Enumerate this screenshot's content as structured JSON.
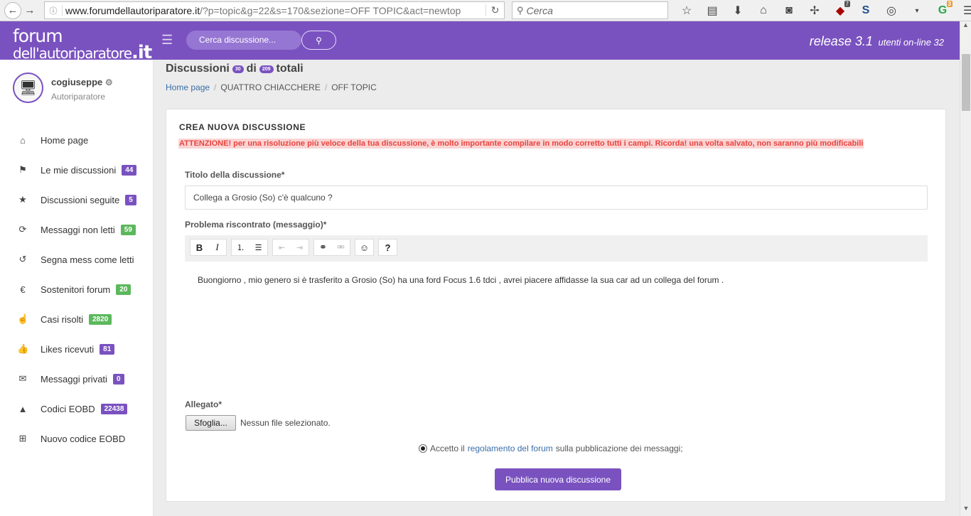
{
  "browser": {
    "url_host": "www.forumdellautoriparatore.it",
    "url_path": "/?p=topic&g=22&s=170&sezione=OFF TOPIC&act=newtop",
    "search_placeholder": "Cerca",
    "ublock_badge": "7",
    "ext_badge": "3"
  },
  "header": {
    "logo_line1": "forum",
    "logo_line2": "dell'autoriparatore",
    "logo_tld": ".it",
    "search_placeholder": "Cerca discussione...",
    "release": "release 3.1",
    "online": "utenti on-line 32"
  },
  "user": {
    "name": "cogiuseppe",
    "role": "Autoriparatore"
  },
  "menu": [
    {
      "label": "Home page",
      "icon": "home-icon",
      "glyph": "⌂",
      "badge": "",
      "color": ""
    },
    {
      "label": "Le mie discussioni",
      "icon": "flag-icon",
      "glyph": "⚑",
      "badge": "44",
      "color": "#7a52c0"
    },
    {
      "label": "Discussioni seguite",
      "icon": "star-icon",
      "glyph": "★",
      "badge": "5",
      "color": "#7a52c0"
    },
    {
      "label": "Messaggi non letti",
      "icon": "refresh-icon",
      "glyph": "⟳",
      "badge": "59",
      "color": "#5cb85c"
    },
    {
      "label": "Segna mess come letti",
      "icon": "history-icon",
      "glyph": "↺",
      "badge": "",
      "color": ""
    },
    {
      "label": "Sostenitori forum",
      "icon": "euro-icon",
      "glyph": "€",
      "badge": "20",
      "color": "#5cb85c"
    },
    {
      "label": "Casi risolti",
      "icon": "hand-icon",
      "glyph": "☝",
      "badge": "2820",
      "color": "#5cb85c"
    },
    {
      "label": "Likes ricevuti",
      "icon": "thumbs-up-icon",
      "glyph": "👍",
      "badge": "81",
      "color": "#7a52c0"
    },
    {
      "label": "Messaggi privati",
      "icon": "chat-icon",
      "glyph": "✉",
      "badge": "0",
      "color": "#7a52c0"
    },
    {
      "label": "Codici EOBD",
      "icon": "warning-icon",
      "glyph": "▲",
      "badge": "22438",
      "color": "#7a52c0"
    },
    {
      "label": "Nuovo codice EOBD",
      "icon": "add-box-icon",
      "glyph": "⊞",
      "badge": "",
      "color": ""
    }
  ],
  "page": {
    "title_prefix": "Discussioni",
    "count_shown": "30",
    "title_mid": "di",
    "count_total": "209",
    "title_suffix": "totali",
    "breadcrumb": [
      "Home page",
      "QUATTRO CHIACCHERE",
      "OFF TOPIC"
    ]
  },
  "form": {
    "card_title": "CREA NUOVA DISCUSSIONE",
    "warning": "ATTENZIONE! per una risoluzione più veloce della tua discussione, è molto importante compilare in modo corretto tutti i campi. Ricorda! una volta salvato, non saranno più modificabili",
    "title_label": "Titolo della discussione*",
    "title_value": "Collega a Grosio (So) c'è qualcuno ?",
    "message_label": "Problema riscontrato (messaggio)*",
    "message_value": "Buongiorno , mio genero si è trasferito a Grosio (So) ha una ford Focus 1.6 tdci , avrei piacere affidasse la sua car ad un collega del forum .",
    "attachment_label": "Allegato*",
    "file_button": "Sfoglia...",
    "file_status": "Nessun file selezionato.",
    "accept_prefix": "Accetto il",
    "accept_link": "regolamento del forum",
    "accept_suffix": "sulla pubblicazione dei messaggi;",
    "submit": "Pubblica nuova discussione"
  },
  "colors": {
    "brand": "#7a52c0",
    "success": "#5cb85c",
    "warning_text": "#e8443e",
    "warning_bg": "#fbd4d4"
  }
}
